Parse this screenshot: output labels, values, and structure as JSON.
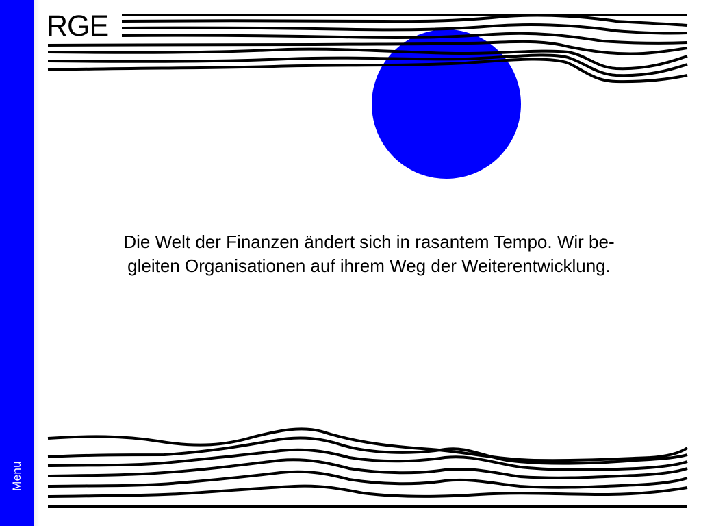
{
  "brand": {
    "logo_text": "RGE",
    "accent_color": "#0000ff"
  },
  "sidebar": {
    "menu_label": "Menu"
  },
  "hero": {
    "tagline_line1": "Die Welt der Finanzen ändert sich in rasantem Tempo. Wir be-",
    "tagline_line2": "gleiten Organisationen auf ihrem Weg der Weiterentwicklung."
  }
}
